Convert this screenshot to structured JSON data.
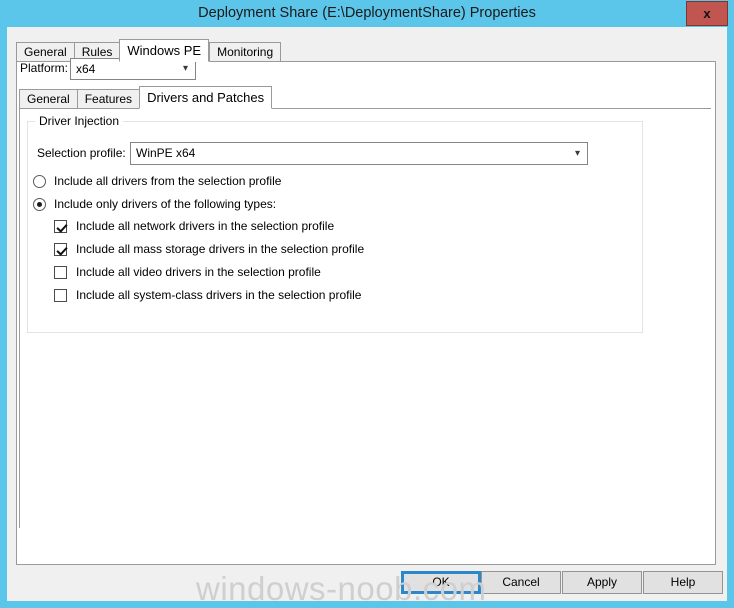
{
  "window": {
    "title": "Deployment Share (E:\\DeploymentShare) Properties",
    "close_label": "x",
    "titlebar_color": "#5bc5ea",
    "close_button_color": "#c0564f"
  },
  "outer_tabs": [
    {
      "label": "General",
      "active": false
    },
    {
      "label": "Rules",
      "active": false
    },
    {
      "label": "Windows PE",
      "active": true
    },
    {
      "label": "Monitoring",
      "active": false
    }
  ],
  "platform": {
    "label": "Platform:",
    "value": "x64",
    "arrow": "chevron-down-icon"
  },
  "inner_tabs": [
    {
      "label": "General",
      "active": false
    },
    {
      "label": "Features",
      "active": false
    },
    {
      "label": "Drivers and Patches",
      "active": true
    }
  ],
  "driver_injection": {
    "group_title": "Driver Injection",
    "selection_profile": {
      "label": "Selection profile:",
      "value": "WinPE x64",
      "arrow": "chevron-down-icon"
    },
    "radios": [
      {
        "label": "Include all drivers from the selection profile",
        "checked": false
      },
      {
        "label": "Include only drivers of the following types:",
        "checked": true
      }
    ],
    "checkboxes": [
      {
        "label": "Include all network drivers in the selection profile",
        "checked": true
      },
      {
        "label": "Include all mass storage drivers in the selection profile",
        "checked": true
      },
      {
        "label": "Include all video drivers in the selection profile",
        "checked": false
      },
      {
        "label": "Include all system-class drivers in the selection profile",
        "checked": false
      }
    ]
  },
  "footer_buttons": [
    {
      "label": "OK",
      "default": true
    },
    {
      "label": "Cancel",
      "default": false
    },
    {
      "label": "Apply",
      "default": false
    },
    {
      "label": "Help",
      "default": false
    }
  ],
  "watermark": "windows-noob.com"
}
